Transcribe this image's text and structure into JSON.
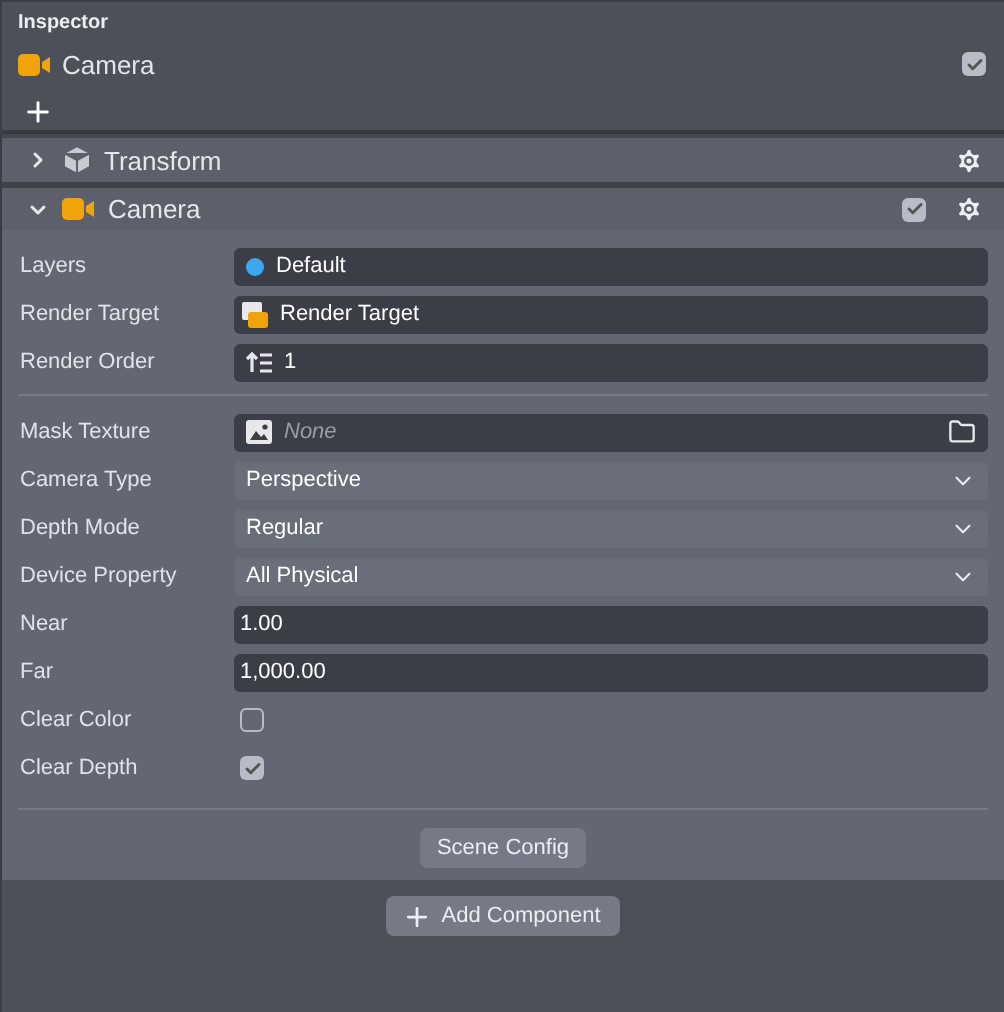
{
  "panel": {
    "title": "Inspector"
  },
  "node": {
    "name": "Camera",
    "enabled": true
  },
  "components": [
    {
      "name": "Transform",
      "kind": "transform",
      "expanded": false
    },
    {
      "name": "Camera",
      "kind": "camera",
      "expanded": true,
      "enabled": true
    }
  ],
  "property_groups": [
    [
      {
        "label": "Layers",
        "kind": "layer",
        "value": "Default",
        "color": "#3ea6ef"
      },
      {
        "label": "Render Target",
        "kind": "asset",
        "value": "Render Target"
      },
      {
        "label": "Render Order",
        "kind": "order",
        "value": "1"
      }
    ],
    [
      {
        "label": "Mask Texture",
        "kind": "texture",
        "placeholder": "None"
      },
      {
        "label": "Camera Type",
        "kind": "select",
        "value": "Perspective"
      },
      {
        "label": "Depth Mode",
        "kind": "select",
        "value": "Regular"
      },
      {
        "label": "Device Property",
        "kind": "select",
        "value": "All Physical"
      },
      {
        "label": "Near",
        "kind": "number",
        "value": "1.00"
      },
      {
        "label": "Far",
        "kind": "number",
        "value": "1,000.00"
      },
      {
        "label": "Clear Color",
        "kind": "checkbox",
        "checked": false
      },
      {
        "label": "Clear Depth",
        "kind": "checkbox",
        "checked": true
      }
    ]
  ],
  "scene_config_button": "Scene Config",
  "add_component_button": "Add Component"
}
